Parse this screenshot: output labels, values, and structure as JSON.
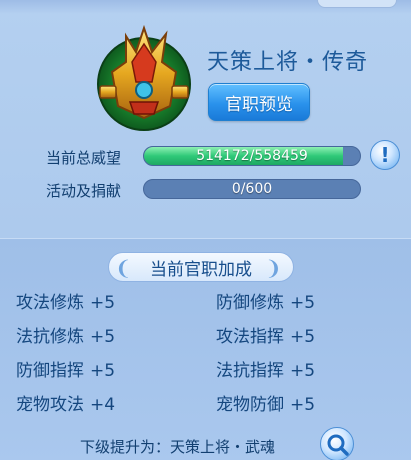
{
  "rank": {
    "title": "天策上将・传奇",
    "preview_button": "官职预览"
  },
  "stats": {
    "prestige_label": "当前总威望",
    "prestige_value": "514172/558459",
    "prestige_progress": 0.9207,
    "donation_label": "活动及捐献",
    "donation_value": "0/600",
    "donation_progress": 0
  },
  "bonus": {
    "header": "当前官职加成",
    "items": [
      {
        "name": "攻法修炼",
        "value": "+5"
      },
      {
        "name": "防御修炼",
        "value": "+5"
      },
      {
        "name": "法抗修炼",
        "value": "+5"
      },
      {
        "name": "攻法指挥",
        "value": "+5"
      },
      {
        "name": "防御指挥",
        "value": "+5"
      },
      {
        "name": "法抗指挥",
        "value": "+5"
      },
      {
        "name": "宠物攻法",
        "value": "+4"
      },
      {
        "name": "宠物防御",
        "value": "+5"
      }
    ]
  },
  "next": {
    "text": "下级提升为：天策上将・武魂"
  },
  "icons": {
    "emblem": "helmet-emblem-icon",
    "info": "exclamation-info-icon",
    "search": "magnifier-icon"
  },
  "colors": {
    "accent": "#2a92ec",
    "progress_fill": "#2fc978",
    "text_dark": "#14467e"
  }
}
